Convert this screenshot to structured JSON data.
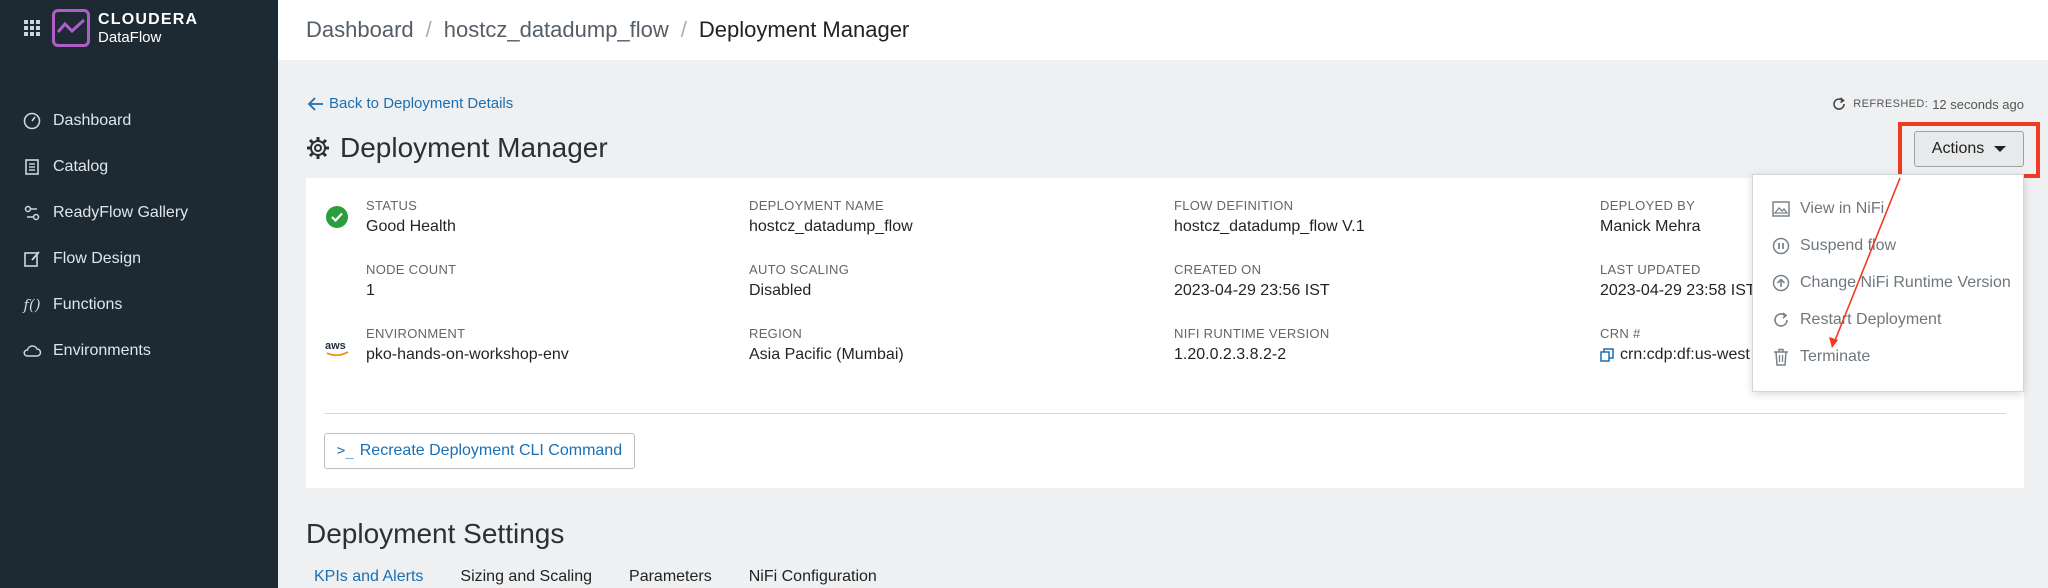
{
  "sidebar": {
    "brand": "CLOUDERA",
    "product": "DataFlow",
    "items": [
      {
        "label": "Dashboard",
        "icon": "dashboard-gauge-icon"
      },
      {
        "label": "Catalog",
        "icon": "catalog-icon"
      },
      {
        "label": "ReadyFlow Gallery",
        "icon": "readyflow-icon"
      },
      {
        "label": "Flow Design",
        "icon": "flow-design-icon"
      },
      {
        "label": "Functions",
        "icon": "functions-icon"
      },
      {
        "label": "Environments",
        "icon": "cloud-icon"
      }
    ]
  },
  "breadcrumb": {
    "items": [
      "Dashboard",
      "hostcz_datadump_flow"
    ],
    "current": "Deployment Manager",
    "separator": "/"
  },
  "back_link": "Back to Deployment Details",
  "refreshed": {
    "label": "REFRESHED:",
    "value": "12 seconds ago"
  },
  "page_title": "Deployment Manager",
  "actions_label": "Actions",
  "details": {
    "status": {
      "key": "STATUS",
      "value": "Good Health"
    },
    "deployment_name": {
      "key": "DEPLOYMENT NAME",
      "value": "hostcz_datadump_flow"
    },
    "flow_definition": {
      "key": "FLOW DEFINITION",
      "value": "hostcz_datadump_flow V.1"
    },
    "deployed_by": {
      "key": "DEPLOYED BY",
      "value": "Manick Mehra"
    },
    "node_count": {
      "key": "NODE COUNT",
      "value": "1"
    },
    "auto_scaling": {
      "key": "AUTO SCALING",
      "value": "Disabled"
    },
    "created_on": {
      "key": "CREATED ON",
      "value": "2023-04-29 23:56 IST"
    },
    "last_updated": {
      "key": "LAST UPDATED",
      "value": "2023-04-29 23:58 IST"
    },
    "environment": {
      "key": "ENVIRONMENT",
      "value": "pko-hands-on-workshop-env"
    },
    "region": {
      "key": "REGION",
      "value": "Asia Pacific (Mumbai)"
    },
    "nifi_runtime": {
      "key": "NIFI RUNTIME VERSION",
      "value": "1.20.0.2.3.8.2-2"
    },
    "crn": {
      "key": "CRN #",
      "value": "crn:cdp:df:us-west"
    }
  },
  "cli_button": {
    "prompt": ">_",
    "label": "Recreate Deployment CLI Command"
  },
  "aws_badge": "aws",
  "section_title": "Deployment Settings",
  "tabs": [
    "KPIs and Alerts",
    "Sizing and Scaling",
    "Parameters",
    "NiFi Configuration"
  ],
  "active_tab": "KPIs and Alerts",
  "actions_menu": [
    {
      "label": "View in NiFi",
      "icon": "image-icon"
    },
    {
      "label": "Suspend flow",
      "icon": "pause-circle-icon"
    },
    {
      "label": "Change NiFi Runtime Version",
      "icon": "upgrade-circle-icon"
    },
    {
      "label": "Restart Deployment",
      "icon": "restart-icon"
    },
    {
      "label": "Terminate",
      "icon": "trash-icon"
    }
  ],
  "colors": {
    "sidebar_bg": "#1d2a33",
    "brand_purple": "#b05ec7",
    "link_blue": "#1a6fb3",
    "status_green": "#2a9d3c",
    "annotation_red": "#f03a24"
  }
}
